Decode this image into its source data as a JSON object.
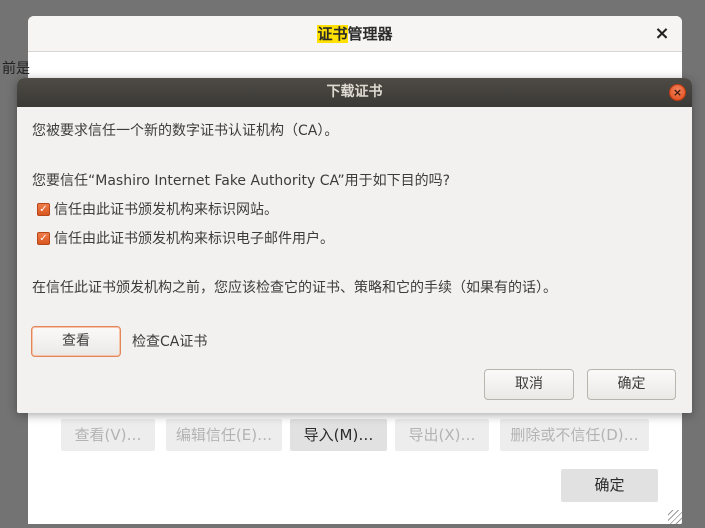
{
  "parent_window": {
    "title_highlight": "证书",
    "title_rest": "管理器",
    "close_glyph": "×",
    "peek_text": "前是",
    "buttons": [
      {
        "label": "查看(V)…",
        "enabled": false
      },
      {
        "label": "编辑信任(E)…",
        "enabled": false
      },
      {
        "label": "导入(M)…",
        "enabled": true
      },
      {
        "label": "导出(X)…",
        "enabled": false
      },
      {
        "label": "删除或不信任(D)…",
        "enabled": false
      }
    ],
    "ok_label": "确定"
  },
  "dialog": {
    "title": "下载证书",
    "close_glyph": "×",
    "intro": "您被要求信任一个新的数字证书认证机构（CA）。",
    "question": "您要信任“Mashiro Internet Fake Authority CA”用于如下目的吗?",
    "checkboxes": [
      {
        "label": "信任由此证书颁发机构来标识网站。",
        "checked": true
      },
      {
        "label": "信任由此证书颁发机构来标识电子邮件用户。",
        "checked": true
      }
    ],
    "advice": "在信任此证书颁发机构之前，您应该检查它的证书、策略和它的手续（如果有的话）。",
    "view_button": "查看",
    "view_hint": "检查CA证书",
    "cancel_button": "取消",
    "ok_button": "确定"
  },
  "colors": {
    "accent": "#e0561c",
    "dialog_titlebar": "#3e3c38",
    "highlight": "#ffe000"
  },
  "icons": {
    "check": "checkmark-icon",
    "close": "close-icon"
  }
}
